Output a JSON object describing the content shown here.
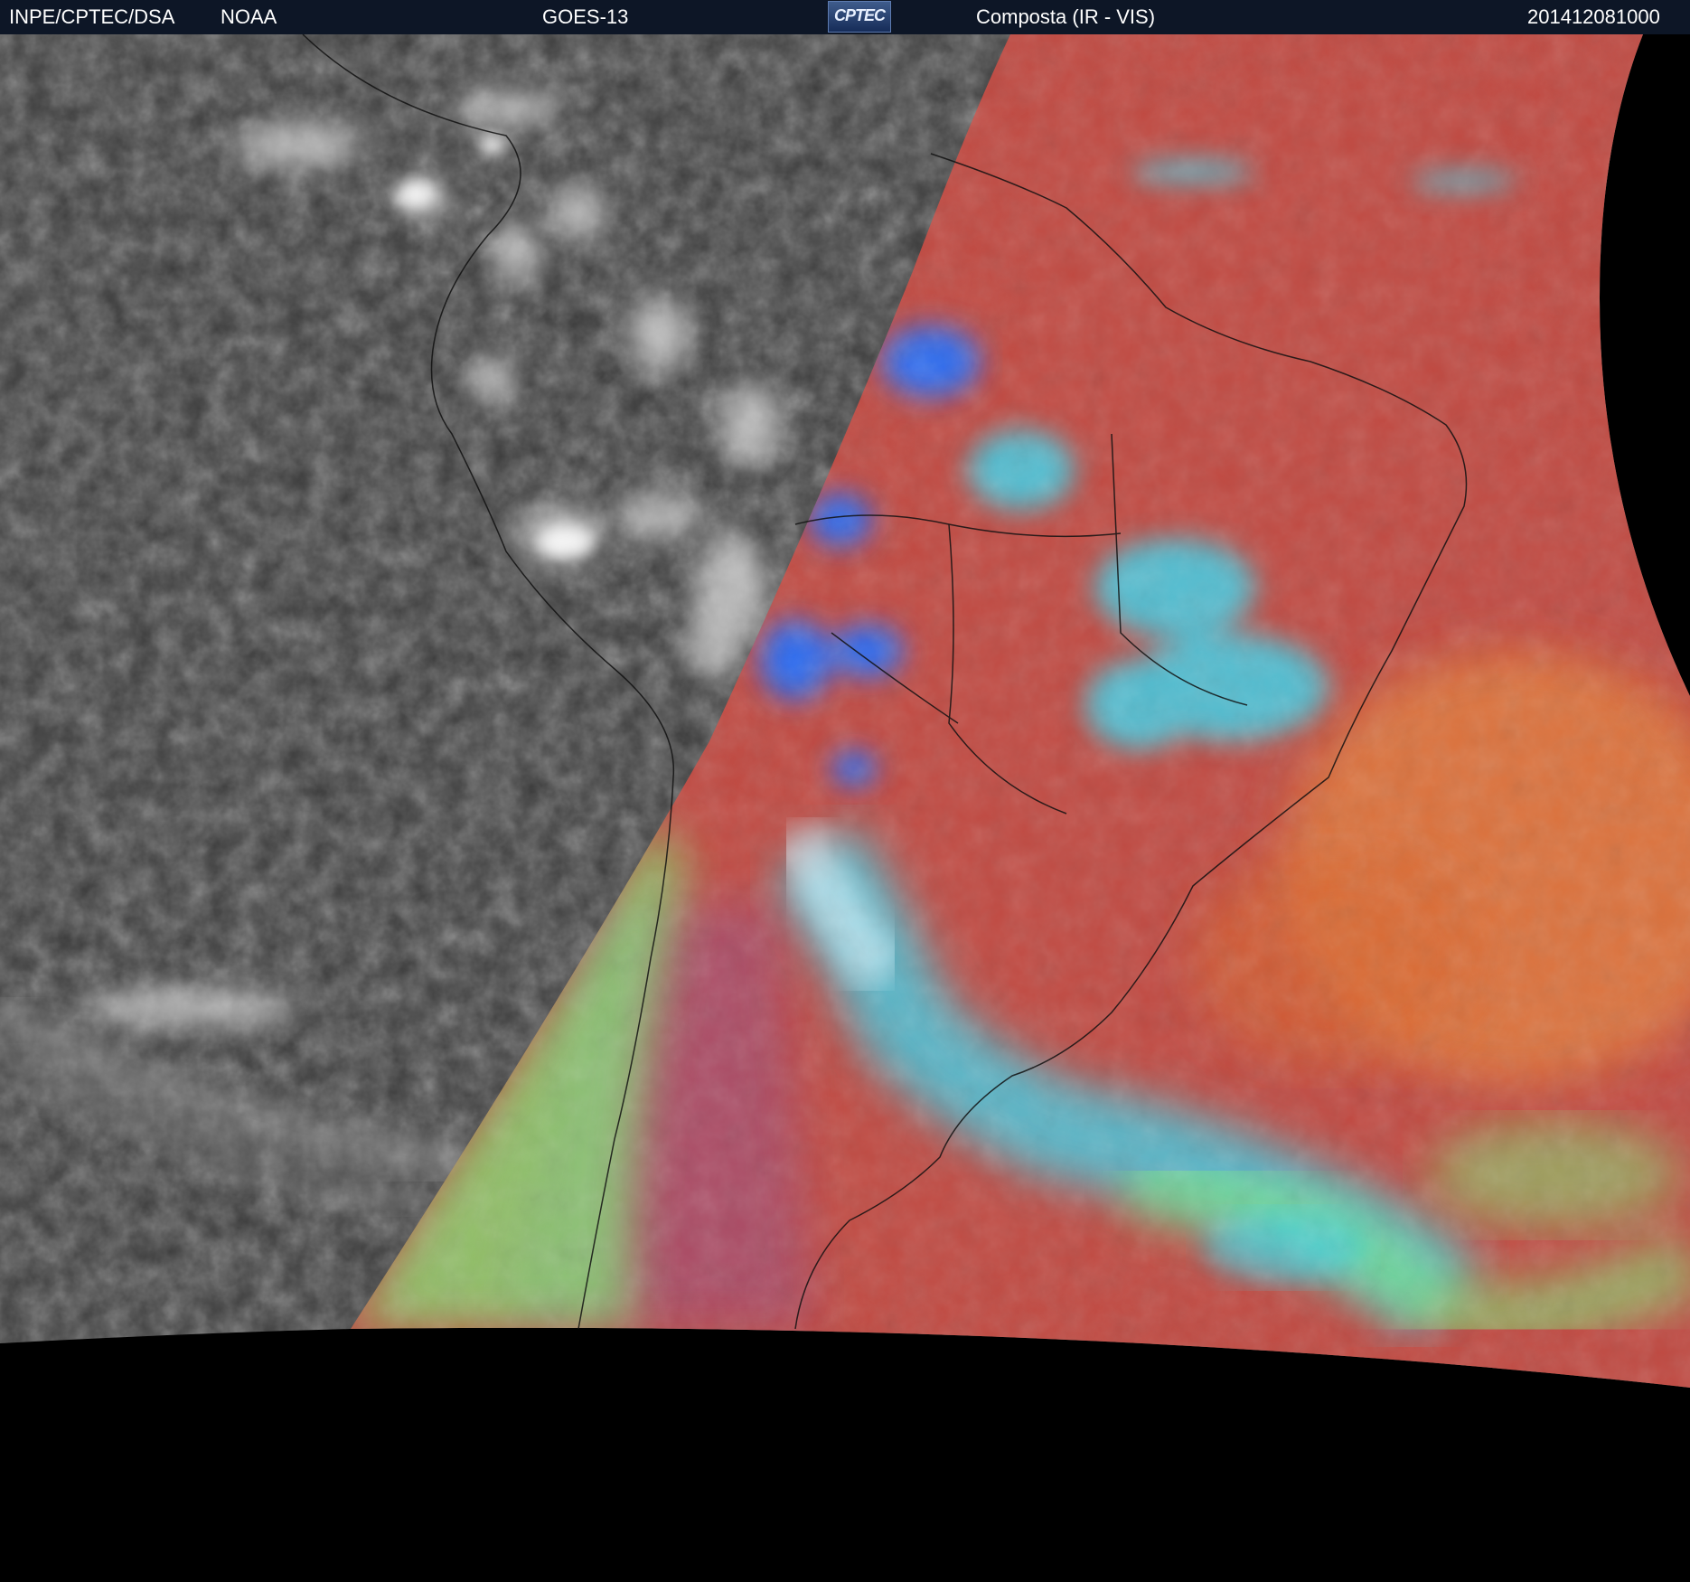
{
  "header": {
    "agency": "INPE/CPTEC/DSA",
    "partner": "NOAA",
    "satellite": "GOES-13",
    "logo_text": "CPTEC",
    "product": "Composta (IR - VIS)",
    "timestamp": "201412081000"
  },
  "colors": {
    "header_bg": "#0d1626",
    "night_side": "#3a3a3a",
    "day_surface": "#c04a42",
    "cold_cloud": "#3fd0e8",
    "deep_convection": "#2f6cf0",
    "low_cloud": "#7ef07a",
    "space": "#000000"
  }
}
